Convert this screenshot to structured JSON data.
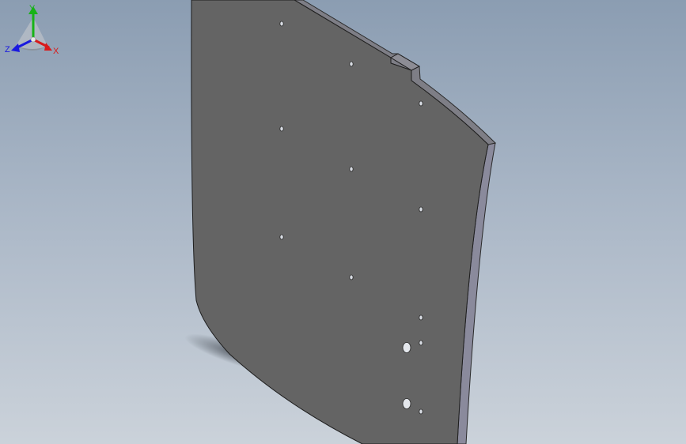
{
  "triad": {
    "x_label": "X",
    "y_label": "Y",
    "z_label": "Z"
  },
  "colors": {
    "background_top": "#8b9db2",
    "background_bottom": "#cbd2da",
    "part_face": "#646464",
    "part_edge_top": "#7a7a80",
    "part_side": "#8a8a9a",
    "axis_x": "#d81b1b",
    "axis_y": "#17b317",
    "axis_z": "#1a1adf"
  },
  "icons": {
    "triad": "view-orientation-triad-icon"
  }
}
